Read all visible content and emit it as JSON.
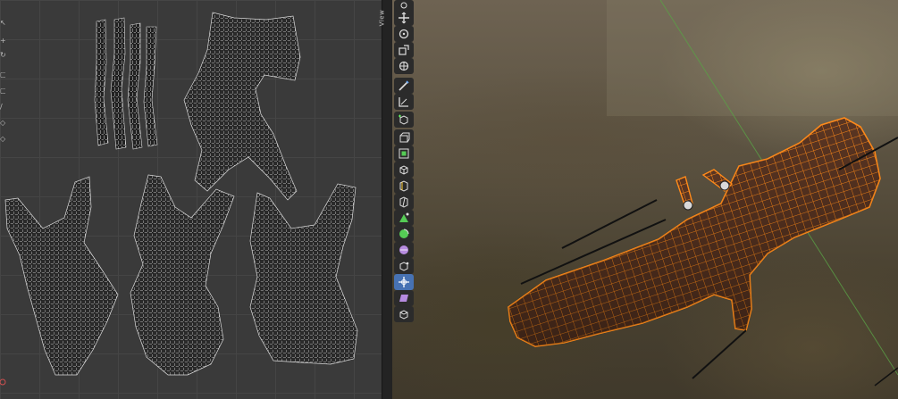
{
  "viewport": {
    "sidebar_tab_label": "View",
    "active_tool": "transform-tool-icon"
  },
  "colors": {
    "uv_background": "#3a3a3a",
    "selection_orange": "#ff8a1a",
    "active_tool_blue": "#4772b3",
    "toolbar_button": "#2b2b2b"
  },
  "uv_editor": {
    "islands": [
      "finger-strip",
      "finger-strip",
      "finger-strip",
      "finger-strip",
      "glove-cuff",
      "glove-hand-left",
      "glove-hand-middle",
      "glove-hand-right"
    ]
  },
  "toolbar_icons": [
    "select-box-icon",
    "cursor-icon",
    "move-icon",
    "rotate-icon",
    "scale-icon",
    "transform-icon",
    "annotate-icon",
    "measure-icon",
    "add-cube-icon",
    "extrude-region-icon",
    "inset-faces-icon",
    "bevel-icon",
    "loop-cut-icon",
    "knife-icon",
    "poly-build-icon",
    "spin-icon",
    "smooth-icon",
    "edge-slide-icon",
    "shrink-fatten-icon",
    "shear-icon",
    "rip-region-icon"
  ]
}
